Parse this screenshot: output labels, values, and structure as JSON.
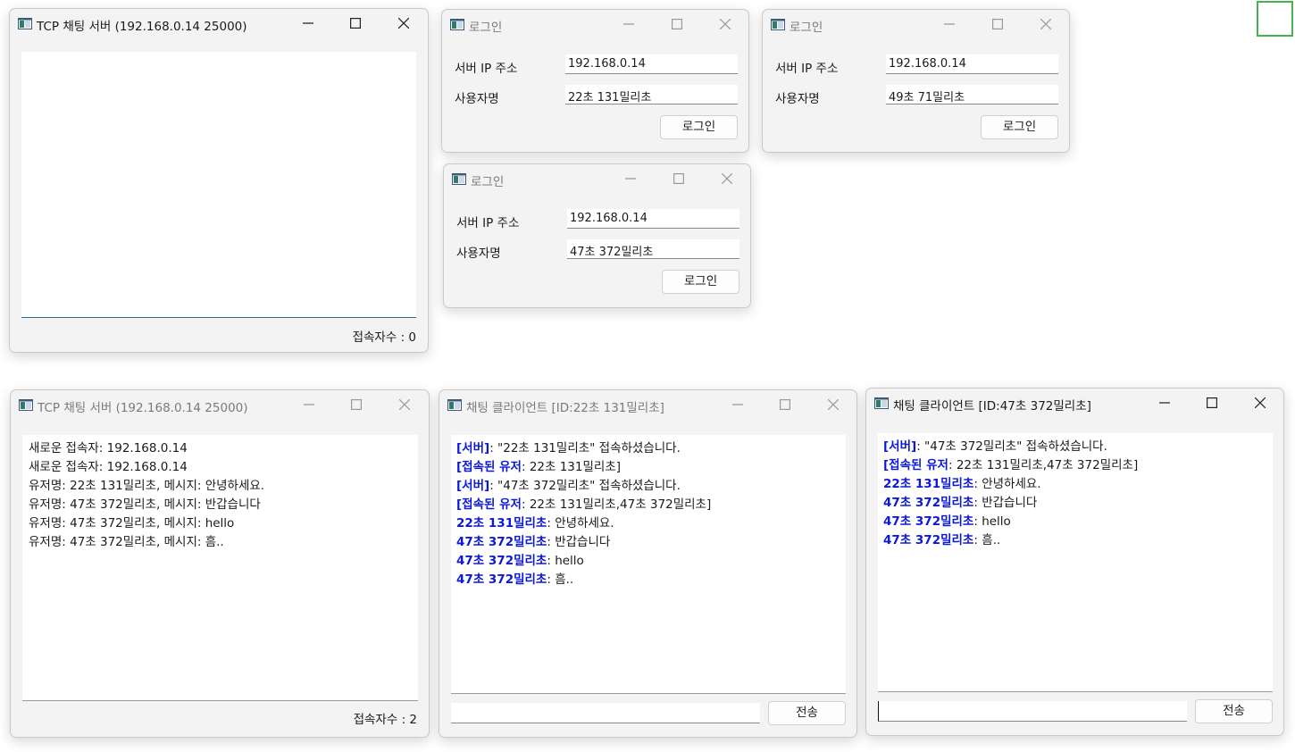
{
  "icons": {
    "app_icon": "app-window-icon",
    "minimize": "minimize-icon",
    "maximize": "maximize-icon",
    "close": "close-icon"
  },
  "colors": {
    "highlight_blue": "#0b19d6",
    "focus_green": "#4caf50",
    "panel_border_blue": "#2d6ea3"
  },
  "server_top": {
    "title": "TCP 채팅 서버 (192.168.0.14 25000)",
    "status": "접속자수 : 0"
  },
  "login1": {
    "title": "로그인",
    "ip_label": "서버 IP 주소",
    "ip_value": "192.168.0.14",
    "user_label": "사용자명",
    "user_value": "22초 131밀리초",
    "button": "로그인"
  },
  "login2": {
    "title": "로그인",
    "ip_label": "서버 IP 주소",
    "ip_value": "192.168.0.14",
    "user_label": "사용자명",
    "user_value": "49초 71밀리초",
    "button": "로그인"
  },
  "login3": {
    "title": "로그인",
    "ip_label": "서버 IP 주소",
    "ip_value": "192.168.0.14",
    "user_label": "사용자명",
    "user_value": "47초 372밀리초",
    "button": "로그인"
  },
  "server_bottom": {
    "title": "TCP 채팅 서버 (192.168.0.14 25000)",
    "log": [
      "새로운 접속자: 192.168.0.14",
      "새로운 접속자: 192.168.0.14",
      "유저명: 22초 131밀리초, 메시지: 안녕하세요.",
      "유저명: 47초 372밀리초, 메시지: 반갑습니다",
      "유저명: 47초 372밀리초, 메시지: hello",
      "유저명: 47초 372밀리초, 메시지: 흠.."
    ],
    "status": "접속자수 : 2"
  },
  "client1": {
    "title": "채팅 클라이언트 [ID:22초 131밀리초]",
    "messages": [
      {
        "sender": "[서버]",
        "text": ": \"22초 131밀리초\" 접속하셨습니다."
      },
      {
        "sender": "[접속된 유저",
        "text": ": 22초 131밀리초]"
      },
      {
        "sender": "[서버]",
        "text": ": \"47초 372밀리초\" 접속하셨습니다."
      },
      {
        "sender": "[접속된 유저",
        "text": ": 22초 131밀리초,47초 372밀리초]"
      },
      {
        "sender": "22초 131밀리초",
        "text": ": 안녕하세요."
      },
      {
        "sender": "47초 372밀리초",
        "text": ": 반갑습니다"
      },
      {
        "sender": "47초 372밀리초",
        "text": ": hello"
      },
      {
        "sender": "47초 372밀리초",
        "text": ": 흠.."
      }
    ],
    "input_value": "",
    "send_button": "전송"
  },
  "client2": {
    "title": "채팅 클라이언트 [ID:47초 372밀리초]",
    "messages": [
      {
        "sender": "[서버]",
        "text": ": \"47초 372밀리초\" 접속하셨습니다."
      },
      {
        "sender": "[접속된 유저",
        "text": ": 22초 131밀리초,47초 372밀리초]"
      },
      {
        "sender": "22초 131밀리초",
        "text": ": 안녕하세요."
      },
      {
        "sender": "47초 372밀리초",
        "text": ": 반갑습니다"
      },
      {
        "sender": "47초 372밀리초",
        "text": ": hello"
      },
      {
        "sender": "47초 372밀리초",
        "text": ": 흠.."
      }
    ],
    "input_value": "",
    "send_button": "전송"
  }
}
